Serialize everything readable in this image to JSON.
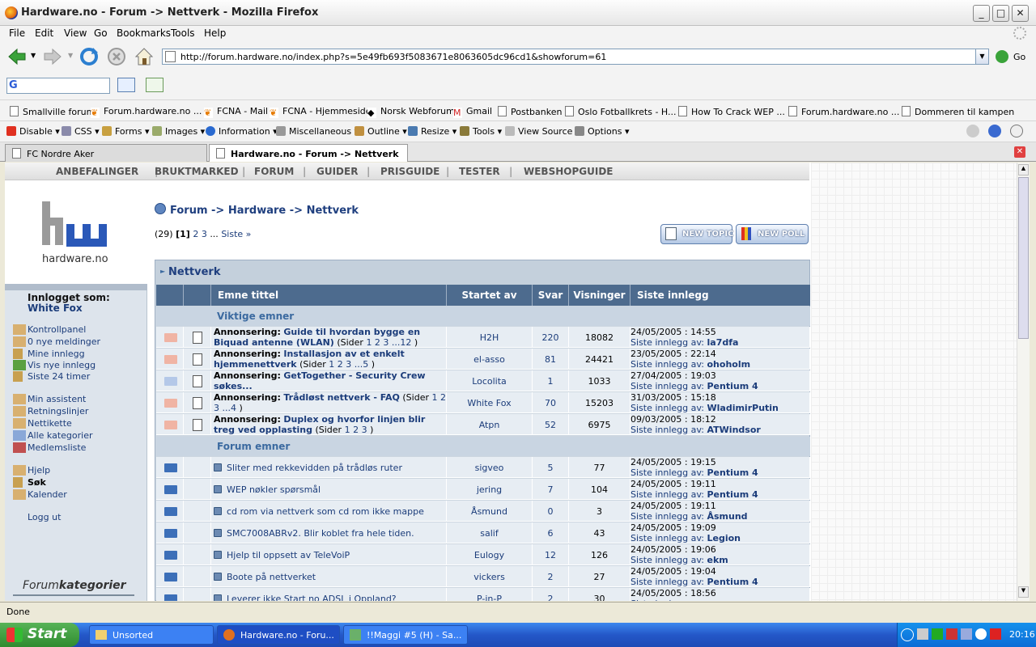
{
  "window": {
    "title": "Hardware.no - Forum -> Nettverk - Mozilla Firefox"
  },
  "menu": [
    "File",
    "Edit",
    "View",
    "Go",
    "Bookmarks",
    "Tools",
    "Help"
  ],
  "nav": {
    "url": "http://forum.hardware.no/index.php?s=5e49fb693f5083671e8063605dc96cd1&showforum=61",
    "go_label": "Go"
  },
  "bookmarks": [
    "Smallville forum",
    "Forum.hardware.no ...",
    "FCNA - Mail",
    "FCNA - Hjemmeside",
    "Norsk Webforum",
    "Gmail",
    "Postbanken",
    "Oslo Fotballkrets - H...",
    "How To Crack WEP ...",
    "Forum.hardware.no ...",
    "Dommeren til kampen"
  ],
  "devbar": [
    "Disable",
    "CSS",
    "Forms",
    "Images",
    "Information",
    "Miscellaneous",
    "Outline",
    "Resize",
    "Tools",
    "View Source",
    "Options"
  ],
  "tabs": [
    {
      "label": "FC Nordre Aker"
    },
    {
      "label": "Hardware.no - Forum -> Nettverk"
    }
  ],
  "sitenav": [
    "ANBEFALINGER",
    "BRUKTMARKED",
    "FORUM",
    "GUIDER",
    "PRISGUIDE",
    "TESTER",
    "WEBSHOPGUIDE"
  ],
  "logo_text": "hardware.no",
  "sidebar": {
    "logged_in_label": "Innlogget som:",
    "user": "White Fox",
    "links1": [
      "Kontrollpanel",
      "0 nye meldinger",
      "Mine innlegg",
      "Vis nye innlegg",
      "Siste 24 timer"
    ],
    "links2": [
      "Min assistent",
      "Retningslinjer",
      "Nettikette",
      "Alle kategorier",
      "Medlemsliste"
    ],
    "links3": [
      "Hjelp",
      "Søk",
      "Kalender"
    ],
    "logout": "Logg ut",
    "footer_a": "Forum",
    "footer_b": "kategorier"
  },
  "breadcrumb": {
    "a": "Forum",
    "sep": "->",
    "b": "Hardware",
    "c": "Nettverk"
  },
  "pagination": {
    "count": "(29)",
    "current": "[1]",
    "p2": "2",
    "p3": "3",
    "dots": "...",
    "last": "Siste »"
  },
  "buttons": {
    "new_topic": "NEW TOPIC",
    "new_poll": "NEW POLL"
  },
  "forum_title": "Nettverk",
  "columns": [
    "Emne tittel",
    "Startet av",
    "Svar",
    "Visninger",
    "Siste innlegg"
  ],
  "sections": {
    "pinned": "Viktige emner",
    "normal": "Forum emner"
  },
  "last_post_prefix": "Siste innlegg av:",
  "announce_prefix": "Annonsering:",
  "pages_prefix": "(Sider",
  "pinned_topics": [
    {
      "title": "Guide til hvordan bygge en Biquad antenne (WLAN)",
      "pages": "1 2 3 ...12",
      "starter": "H2H",
      "replies": "220",
      "views": "18082",
      "last_date": "24/05/2005 : 14:55",
      "last_user": "la7dfa",
      "envcolor": "#f0b4a4"
    },
    {
      "title": "Installasjon av et enkelt hjemmenettverk",
      "pages": "1 2 3 ...5",
      "starter": "el-asso",
      "replies": "81",
      "views": "24421",
      "last_date": "23/05/2005 : 22:14",
      "last_user": "ohoholm",
      "envcolor": "#f0b4a4"
    },
    {
      "title": "GetTogether - Security Crew søkes...",
      "pages": "",
      "starter": "Locolita",
      "replies": "1",
      "views": "1033",
      "last_date": "27/04/2005 : 19:03",
      "last_user": "Pentium 4",
      "envcolor": "#b4c8e8"
    },
    {
      "title": "Trådløst nettverk - FAQ",
      "pages": "1 2 3 ...4",
      "starter": "White Fox",
      "replies": "70",
      "views": "15203",
      "last_date": "31/03/2005 : 15:18",
      "last_user": "WladimirPutin",
      "envcolor": "#f0b4a4"
    },
    {
      "title": "Duplex og hvorfor linjen blir treg ved opplasting",
      "pages": "1 2 3",
      "starter": "Atpn",
      "replies": "52",
      "views": "6975",
      "last_date": "09/03/2005 : 18:12",
      "last_user": "ATWindsor",
      "envcolor": "#f0b4a4"
    }
  ],
  "topics": [
    {
      "title": "Sliter med rekkevidden på trådløs ruter",
      "starter": "sigveo",
      "replies": "5",
      "views": "77",
      "last_date": "24/05/2005 : 19:15",
      "last_user": "Pentium 4"
    },
    {
      "title": "WEP nøkler spørsmål",
      "starter": "jering",
      "replies": "7",
      "views": "104",
      "last_date": "24/05/2005 : 19:11",
      "last_user": "Pentium 4"
    },
    {
      "title": "cd rom via nettverk som cd rom ikke mappe",
      "starter": "Åsmund",
      "replies": "0",
      "views": "3",
      "last_date": "24/05/2005 : 19:11",
      "last_user": "Åsmund"
    },
    {
      "title": "SMC7008ABRv2. Blir koblet fra hele tiden.",
      "starter": "salif",
      "replies": "6",
      "views": "43",
      "last_date": "24/05/2005 : 19:09",
      "last_user": "Legion"
    },
    {
      "title": "Hjelp til oppsett av TeleVoiP",
      "starter": "Eulogy",
      "replies": "12",
      "views": "126",
      "last_date": "24/05/2005 : 19:06",
      "last_user": "ekm"
    },
    {
      "title": "Boote på nettverket",
      "starter": "vickers",
      "replies": "2",
      "views": "27",
      "last_date": "24/05/2005 : 19:04",
      "last_user": "Pentium 4"
    },
    {
      "title": "Leverer ikke Start no ADSL i Oppland?",
      "starter": "P-in-P",
      "replies": "2",
      "views": "30",
      "last_date": "24/05/2005 : 18:56",
      "last_user": ""
    }
  ],
  "status": "Done",
  "taskbar": {
    "start": "Start",
    "tasks": [
      "Unsorted",
      "Hardware.no - Foru...",
      "!!Maggi #5 (H) - Sa..."
    ],
    "clock": "20:16"
  },
  "colors": {
    "accent": "#1b3c7a",
    "header": "#4d6b8e",
    "row": "#e7edf3",
    "section": "#c9d5e2"
  }
}
